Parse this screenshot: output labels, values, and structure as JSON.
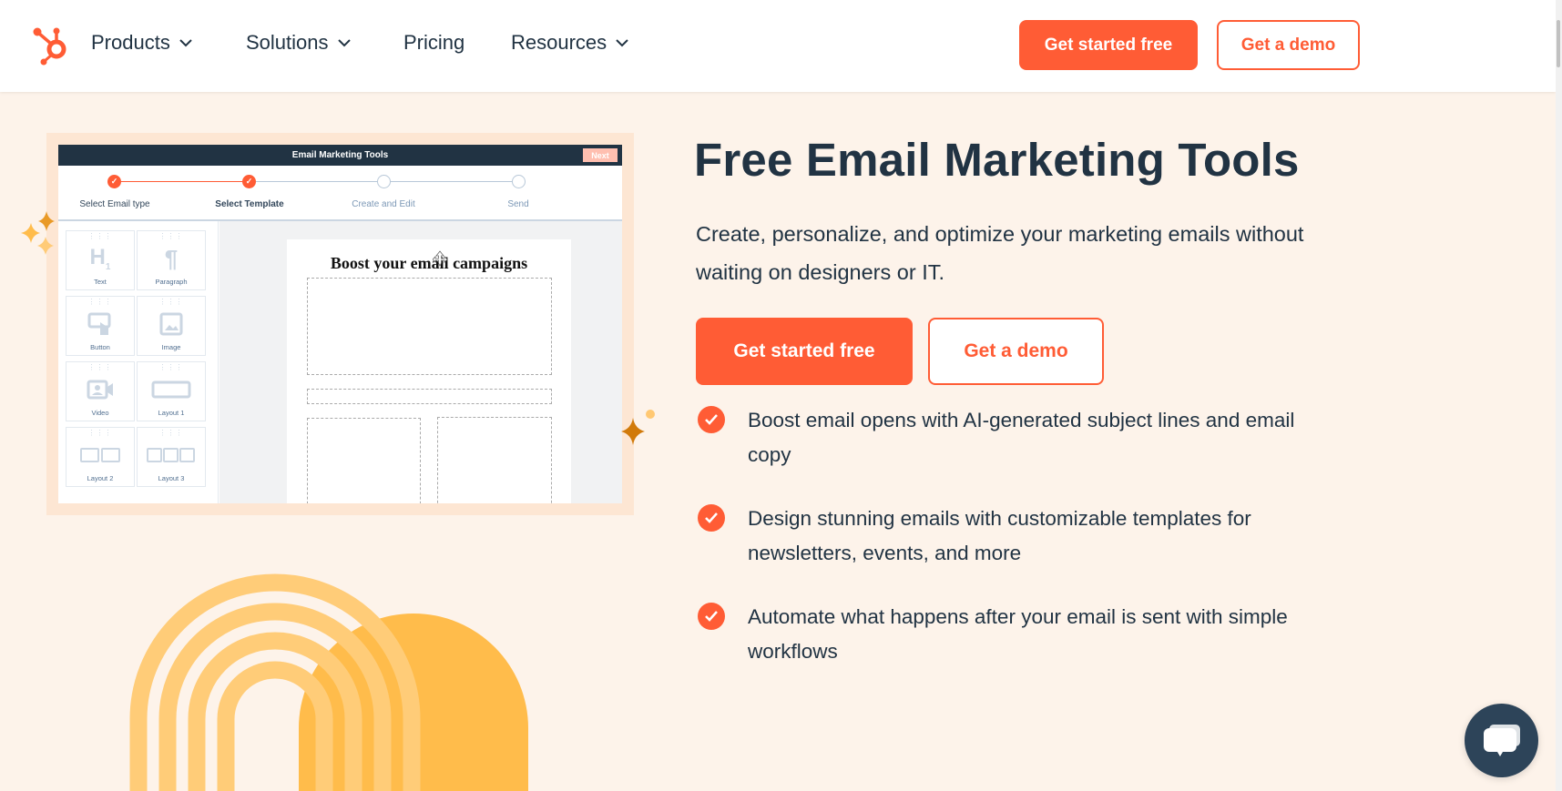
{
  "header": {
    "logo_name": "HubSpot",
    "nav": [
      {
        "label": "Products",
        "has_dropdown": true
      },
      {
        "label": "Solutions",
        "has_dropdown": true
      },
      {
        "label": "Pricing",
        "has_dropdown": false
      },
      {
        "label": "Resources",
        "has_dropdown": true
      }
    ],
    "cta_primary": "Get started free",
    "cta_secondary": "Get a demo"
  },
  "mockup": {
    "window_title": "Email Marketing Tools",
    "next_label": "Next",
    "steps": [
      {
        "label": "Select Email type",
        "status": "done"
      },
      {
        "label": "Select Template",
        "status": "done"
      },
      {
        "label": "Create and Edit",
        "status": "todo"
      },
      {
        "label": "Send",
        "status": "todo"
      }
    ],
    "tiles": [
      {
        "label": "Text",
        "icon": "heading-icon"
      },
      {
        "label": "Paragraph",
        "icon": "paragraph-icon"
      },
      {
        "label": "Button",
        "icon": "button-icon"
      },
      {
        "label": "Image",
        "icon": "image-icon"
      },
      {
        "label": "Video",
        "icon": "video-icon"
      },
      {
        "label": "Layout 1",
        "icon": "layout-1-icon"
      },
      {
        "label": "Layout 2",
        "icon": "layout-2-icon"
      },
      {
        "label": "Layout 3",
        "icon": "layout-3-icon"
      }
    ],
    "email_heading": "Boost your email campaigns"
  },
  "hero": {
    "title": "Free Email Marketing Tools",
    "subtitle": "Create, personalize, and optimize your marketing emails without waiting on designers or IT.",
    "cta_primary": "Get started free",
    "cta_secondary": "Get a demo",
    "features": [
      "Boost email opens with AI-generated subject lines and email copy",
      "Design stunning emails with customizable templates for newsletters, events, and more",
      "Automate what happens after your email is sent with simple workflows"
    ]
  },
  "colors": {
    "brand": "#ff5c35",
    "text": "#213343",
    "background": "#fdf3ea",
    "chat": "#2d4459"
  }
}
